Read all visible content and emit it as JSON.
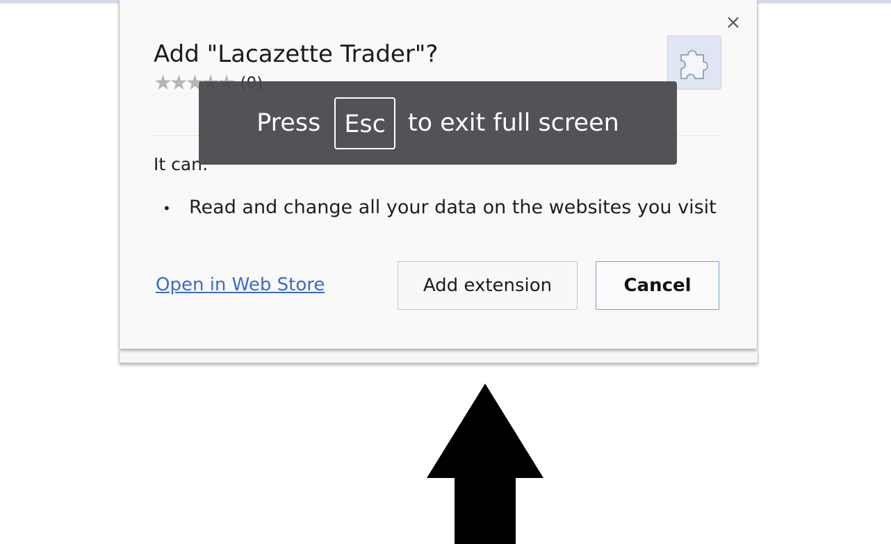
{
  "dialog": {
    "title": "Add \"Lacazette Trader\"?",
    "close_glyph": "×",
    "icon": "puzzle-piece-icon",
    "rating": {
      "stars": 0,
      "max_stars": 5,
      "count_label": "(0)"
    },
    "permissions_heading": "It can:",
    "permissions": [
      "Read and change all your data on the websites you visit"
    ],
    "webstore_link": "Open in Web Store",
    "add_button": "Add extension",
    "cancel_button": "Cancel"
  },
  "fullscreen_toast": {
    "prefix": "Press",
    "key": "Esc",
    "suffix": "to exit full screen"
  },
  "overlay": {
    "arrow_icon": "up-arrow-icon"
  },
  "colors": {
    "link": "#3b6bc9",
    "cancel_border": "#6f9ad9",
    "toast_bg": "#46484c",
    "top_strip": "#d6dbe9"
  }
}
